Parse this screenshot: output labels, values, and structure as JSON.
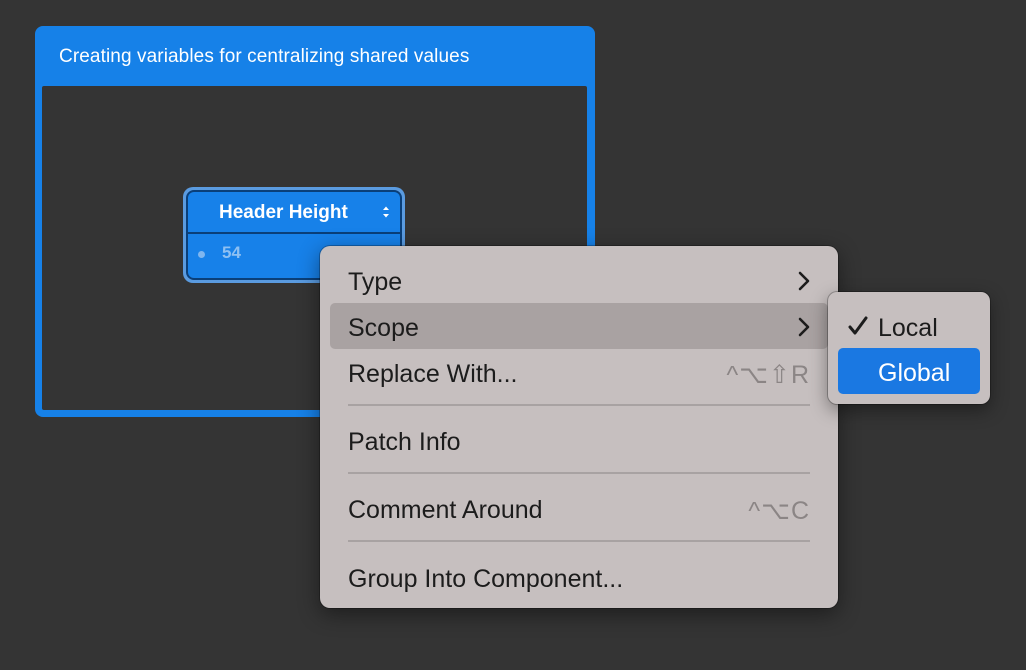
{
  "comment": {
    "title": "Creating variables for centralizing shared values"
  },
  "patch": {
    "title": "Header Height",
    "value": "54",
    "stepper_icon": "up-down-stepper-icon"
  },
  "context_menu": {
    "items": [
      {
        "label": "Type",
        "has_submenu": true
      },
      {
        "label": "Scope",
        "has_submenu": true,
        "highlighted": true
      },
      {
        "label": "Replace With...",
        "shortcut": "^⌥⇧R"
      },
      {
        "label": "Patch Info"
      },
      {
        "label": "Comment Around",
        "shortcut": "^⌥C"
      },
      {
        "label": "Group Into Component..."
      }
    ]
  },
  "scope_submenu": {
    "items": [
      {
        "label": "Local",
        "checked": true
      },
      {
        "label": "Global",
        "selected": true
      }
    ]
  },
  "colors": {
    "canvas": "#343434",
    "comment_blue": "#1681e8",
    "menu_bg": "#c6bfbf",
    "selection_blue": "#1a78e2"
  }
}
